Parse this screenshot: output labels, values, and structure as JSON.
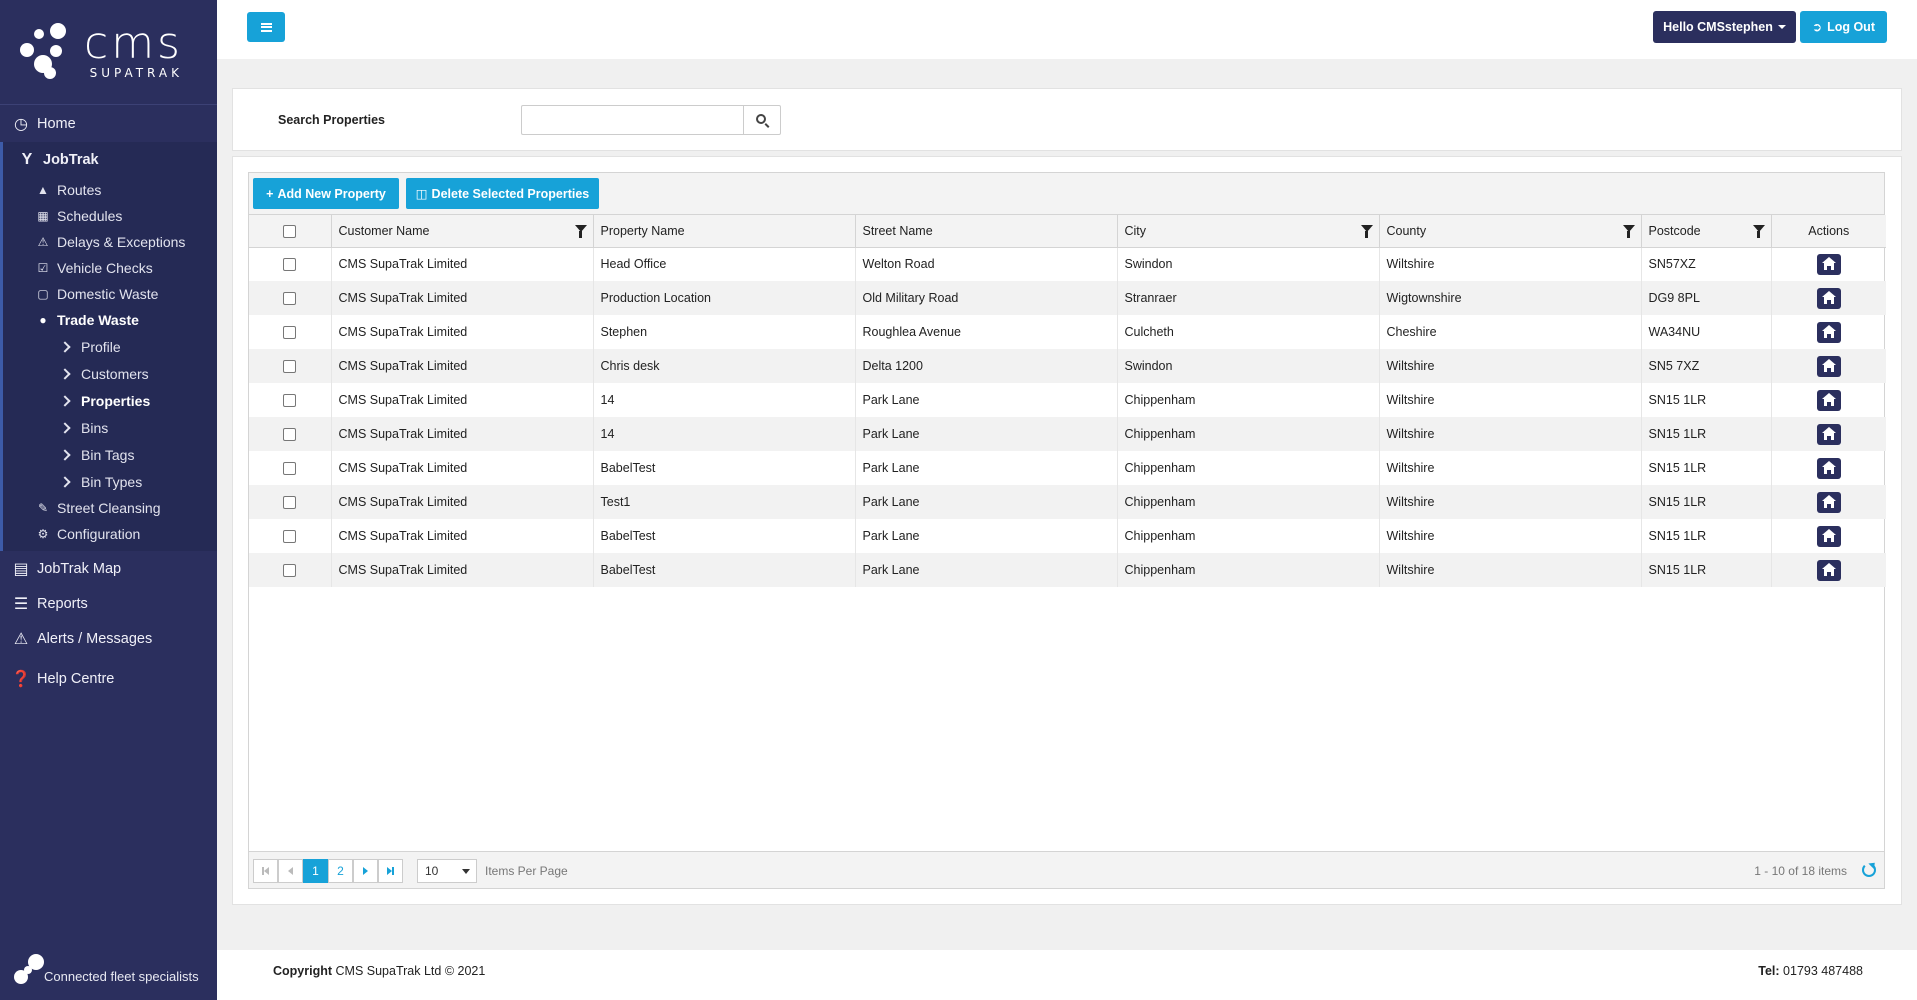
{
  "brand": {
    "logo_text": "cms",
    "logo_sub": "SUPATRAK",
    "tagline": "Connected fleet specialists"
  },
  "colors": {
    "sidebar": "#2b2f5e",
    "accent": "#17a2d8",
    "navy_button": "#2b2f5e"
  },
  "sidebar": {
    "home": {
      "label": "Home",
      "icon": "gauge-icon"
    },
    "jobtrak": {
      "label": "JobTrak",
      "icon": "fork-icon",
      "items": [
        {
          "label": "Routes",
          "icon": "road-icon"
        },
        {
          "label": "Schedules",
          "icon": "calendar-icon"
        },
        {
          "label": "Delays & Exceptions",
          "icon": "warning-icon"
        },
        {
          "label": "Vehicle Checks",
          "icon": "checkbox-icon"
        },
        {
          "label": "Domestic Waste",
          "icon": "bin-icon"
        }
      ],
      "trade_waste": {
        "label": "Trade Waste",
        "icon": "users-icon",
        "items": [
          {
            "label": "Profile"
          },
          {
            "label": "Customers"
          },
          {
            "label": "Properties"
          },
          {
            "label": "Bins"
          },
          {
            "label": "Bin Tags"
          },
          {
            "label": "Bin Types"
          }
        ]
      },
      "after_items": [
        {
          "label": "Street Cleansing",
          "icon": "broom-icon"
        },
        {
          "label": "Configuration",
          "icon": "gear-icon"
        }
      ]
    },
    "bottom_items": [
      {
        "label": "JobTrak Map",
        "icon": "map-icon"
      },
      {
        "label": "Reports",
        "icon": "clipboard-icon"
      },
      {
        "label": "Alerts / Messages",
        "icon": "warning-icon"
      },
      {
        "label": "Help Centre",
        "icon": "question-icon"
      }
    ]
  },
  "topbar": {
    "greeting": "Hello CMSstephen",
    "logout": "Log Out"
  },
  "search": {
    "label": "Search Properties",
    "value": "",
    "placeholder": ""
  },
  "toolbar": {
    "add": "Add New Property",
    "delete": "Delete Selected Properties"
  },
  "table": {
    "columns": [
      "Customer Name",
      "Property Name",
      "Street Name",
      "City",
      "County",
      "Postcode",
      "Actions"
    ],
    "rows": [
      [
        "CMS SupaTrak Limited",
        "Head Office",
        "Welton Road",
        "Swindon",
        "Wiltshire",
        "SN57XZ"
      ],
      [
        "CMS SupaTrak Limited",
        "Production Location",
        "Old Military Road",
        "Stranraer",
        "Wigtownshire",
        "DG9 8PL"
      ],
      [
        "CMS SupaTrak Limited",
        "Stephen",
        "Roughlea Avenue",
        "Culcheth",
        "Cheshire",
        "WA34NU"
      ],
      [
        "CMS SupaTrak Limited",
        "Chris desk",
        "Delta 1200",
        "Swindon",
        "Wiltshire",
        "SN5 7XZ"
      ],
      [
        "CMS SupaTrak Limited",
        "14",
        "Park Lane",
        "Chippenham",
        "Wiltshire",
        "SN15 1LR"
      ],
      [
        "CMS SupaTrak Limited",
        "14",
        "Park Lane",
        "Chippenham",
        "Wiltshire",
        "SN15 1LR"
      ],
      [
        "CMS SupaTrak Limited",
        "BabelTest",
        "Park Lane",
        "Chippenham",
        "Wiltshire",
        "SN15 1LR"
      ],
      [
        "CMS SupaTrak Limited",
        "Test1",
        "Park Lane",
        "Chippenham",
        "Wiltshire",
        "SN15 1LR"
      ],
      [
        "CMS SupaTrak Limited",
        "BabelTest",
        "Park Lane",
        "Chippenham",
        "Wiltshire",
        "SN15 1LR"
      ],
      [
        "CMS SupaTrak Limited",
        "BabelTest",
        "Park Lane",
        "Chippenham",
        "Wiltshire",
        "SN15 1LR"
      ]
    ]
  },
  "pager": {
    "pages": [
      "1",
      "2"
    ],
    "current": "1",
    "per_page": "10",
    "per_page_label": "Items Per Page",
    "info": "1 - 10 of 18 items"
  },
  "footer": {
    "copyright_label": "Copyright",
    "copyright_text": "CMS SupaTrak Ltd © 2021",
    "tel_label": "Tel:",
    "tel_value": "01793 487488"
  }
}
